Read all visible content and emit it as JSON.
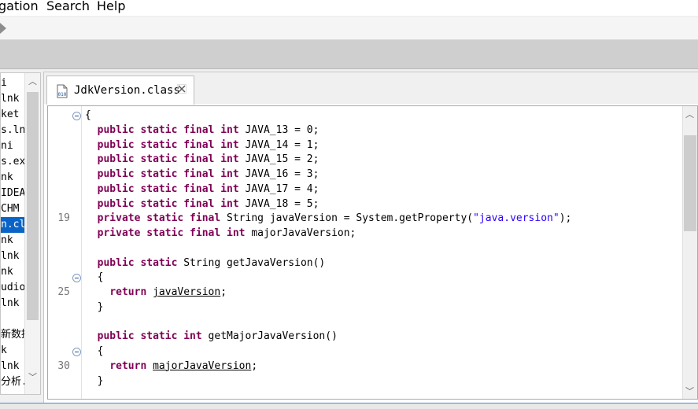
{
  "menubar": {
    "items": [
      {
        "label": "gation"
      },
      {
        "label": "Search"
      },
      {
        "label": "Help"
      }
    ]
  },
  "left_panel": {
    "selected_index": 7,
    "items": [
      {
        "label": "i"
      },
      {
        "label": "lnk"
      },
      {
        "label": "ket"
      },
      {
        "label": "s.ln"
      },
      {
        "label": "ni"
      },
      {
        "label": "s.ex"
      },
      {
        "label": "nk"
      },
      {
        "label": "IDEA"
      },
      {
        "label": "CHM"
      },
      {
        "label": "n.cl"
      },
      {
        "label": "nk"
      },
      {
        "label": "lnk"
      },
      {
        "label": "nk"
      },
      {
        "label": "udio"
      },
      {
        "label": "lnk"
      },
      {
        "label": ""
      },
      {
        "label": "新数据"
      },
      {
        "label": "k"
      },
      {
        "label": "lnk"
      },
      {
        "label": "分析."
      }
    ]
  },
  "editor": {
    "tab": {
      "title": "JdkVersion.class",
      "icon": "class-file-icon",
      "close_icon": "close-icon"
    },
    "lines": [
      {
        "num": "",
        "fold": true,
        "parts": [
          {
            "t": "{",
            "c": ""
          }
        ]
      },
      {
        "num": "",
        "fold": false,
        "parts": [
          {
            "t": "  ",
            "c": ""
          },
          {
            "t": "public static final int",
            "c": "kw"
          },
          {
            "t": " JAVA_13 = 0;",
            "c": ""
          }
        ]
      },
      {
        "num": "",
        "fold": false,
        "parts": [
          {
            "t": "  ",
            "c": ""
          },
          {
            "t": "public static final int",
            "c": "kw"
          },
          {
            "t": " JAVA_14 = 1;",
            "c": ""
          }
        ]
      },
      {
        "num": "",
        "fold": false,
        "parts": [
          {
            "t": "  ",
            "c": ""
          },
          {
            "t": "public static final int",
            "c": "kw"
          },
          {
            "t": " JAVA_15 = 2;",
            "c": ""
          }
        ]
      },
      {
        "num": "",
        "fold": false,
        "parts": [
          {
            "t": "  ",
            "c": ""
          },
          {
            "t": "public static final int",
            "c": "kw"
          },
          {
            "t": " JAVA_16 = 3;",
            "c": ""
          }
        ]
      },
      {
        "num": "",
        "fold": false,
        "parts": [
          {
            "t": "  ",
            "c": ""
          },
          {
            "t": "public static final int",
            "c": "kw"
          },
          {
            "t": " JAVA_17 = 4;",
            "c": ""
          }
        ]
      },
      {
        "num": "",
        "fold": false,
        "parts": [
          {
            "t": "  ",
            "c": ""
          },
          {
            "t": "public static final int",
            "c": "kw"
          },
          {
            "t": " JAVA_18 = 5;",
            "c": ""
          }
        ]
      },
      {
        "num": "19",
        "fold": false,
        "parts": [
          {
            "t": "  ",
            "c": ""
          },
          {
            "t": "private static final",
            "c": "kw"
          },
          {
            "t": " String javaVersion = System.getProperty(",
            "c": ""
          },
          {
            "t": "\"java.version\"",
            "c": "str"
          },
          {
            "t": ");",
            "c": ""
          }
        ]
      },
      {
        "num": "",
        "fold": false,
        "parts": [
          {
            "t": "  ",
            "c": ""
          },
          {
            "t": "private static final int",
            "c": "kw"
          },
          {
            "t": " majorJavaVersion;",
            "c": ""
          }
        ]
      },
      {
        "num": "",
        "fold": false,
        "parts": []
      },
      {
        "num": "",
        "fold": false,
        "parts": [
          {
            "t": "  ",
            "c": ""
          },
          {
            "t": "public static",
            "c": "kw"
          },
          {
            "t": " String getJavaVersion()",
            "c": ""
          }
        ]
      },
      {
        "num": "",
        "fold": true,
        "parts": [
          {
            "t": "  {",
            "c": ""
          }
        ]
      },
      {
        "num": "25",
        "fold": false,
        "parts": [
          {
            "t": "    ",
            "c": ""
          },
          {
            "t": "return",
            "c": "kw"
          },
          {
            "t": " ",
            "c": ""
          },
          {
            "t": "javaVersion",
            "c": "ul"
          },
          {
            "t": ";",
            "c": ""
          }
        ]
      },
      {
        "num": "",
        "fold": false,
        "parts": [
          {
            "t": "  }",
            "c": ""
          }
        ]
      },
      {
        "num": "",
        "fold": false,
        "parts": []
      },
      {
        "num": "",
        "fold": false,
        "parts": [
          {
            "t": "  ",
            "c": ""
          },
          {
            "t": "public static int",
            "c": "kw"
          },
          {
            "t": " getMajorJavaVersion()",
            "c": ""
          }
        ]
      },
      {
        "num": "",
        "fold": true,
        "parts": [
          {
            "t": "  {",
            "c": ""
          }
        ]
      },
      {
        "num": "30",
        "fold": false,
        "parts": [
          {
            "t": "    ",
            "c": ""
          },
          {
            "t": "return",
            "c": "kw"
          },
          {
            "t": " ",
            "c": ""
          },
          {
            "t": "majorJavaVersion",
            "c": "ul"
          },
          {
            "t": ";",
            "c": ""
          }
        ]
      },
      {
        "num": "",
        "fold": false,
        "parts": [
          {
            "t": "  }",
            "c": ""
          }
        ]
      }
    ]
  },
  "colors": {
    "keyword": "#7f0055",
    "string": "#2a00ff",
    "selection": "#0a64c8",
    "line_number": "#787878"
  }
}
